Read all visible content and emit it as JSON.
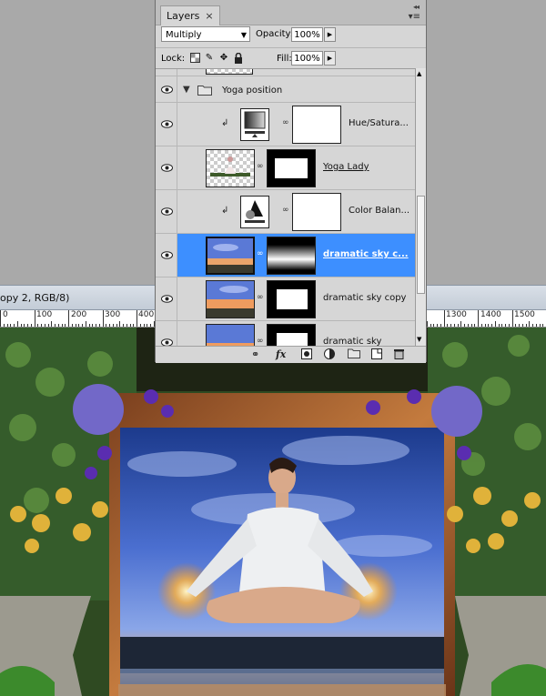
{
  "document": {
    "title_fragment": "opy 2, RGB/8)",
    "ruler_left": [
      "0",
      "100",
      "200",
      "300",
      "400"
    ],
    "ruler_right": [
      "1300",
      "1400",
      "1500"
    ]
  },
  "panel": {
    "tab_label": "Layers",
    "tab_close": "×",
    "collapse_icon": "◂◂",
    "menu_icon": "▾≡",
    "blend_mode": "Multiply",
    "opacity_label": "Opacity:",
    "opacity_value": "100%",
    "lock_label": "Lock:",
    "fill_label": "Fill:",
    "fill_value": "100%"
  },
  "layers": [
    {
      "name": "Yoga position",
      "kind": "group"
    },
    {
      "name": "Hue/Satura...",
      "kind": "adjustment-hue"
    },
    {
      "name": "Yoga Lady",
      "kind": "pixel-mask"
    },
    {
      "name": "Color Balan...",
      "kind": "adjustment-color"
    },
    {
      "name": "dramatic sky c...",
      "kind": "pixel-mask-gradient",
      "selected": true
    },
    {
      "name": "dramatic sky copy",
      "kind": "pixel-mask"
    },
    {
      "name": "dramatic sky",
      "kind": "pixel-mask"
    }
  ],
  "footer_icons": [
    "link-icon",
    "fx-icon",
    "add-mask-icon",
    "adjustment-icon",
    "group-folder-icon",
    "new-layer-icon",
    "trash-icon"
  ],
  "colors": {
    "selected_row": "#3d8fff",
    "panel_bg": "#d6d6d6"
  }
}
